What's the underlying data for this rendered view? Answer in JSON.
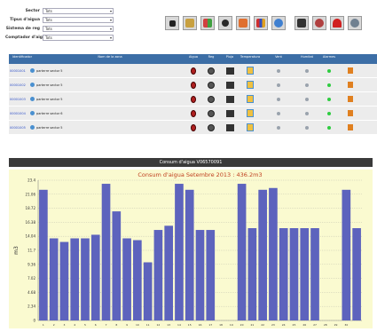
{
  "filters": [
    {
      "label": "Sector",
      "value": "Tots"
    },
    {
      "label": "Tipus d'aigua",
      "value": "Tots"
    },
    {
      "label": "Sistema de reg",
      "value": "Tots"
    },
    {
      "label": "Comptador d'aigua",
      "value": "Tots"
    }
  ],
  "toolbar_icons": [
    "stop-icon",
    "tap-icon",
    "map-icon",
    "valve-icon",
    "calendar-icon",
    "chart-icon",
    "clock-icon",
    "screen-icon",
    "gauge-icon",
    "heart-icon",
    "settings-icon"
  ],
  "table": {
    "headers": {
      "id": "Identificador",
      "name": "Nom de la zona",
      "aigua": "Aigua",
      "reg": "Reg",
      "pluja": "Pluja",
      "temperatura": "Temperatura",
      "vent": "Vent",
      "humitat": "Humitat",
      "alarmes": "Alarmes"
    },
    "rows": [
      {
        "id": "00001001",
        "name": "parterre sector 5",
        "vent": "#9aa3ad",
        "humitat": "#2ecc40"
      },
      {
        "id": "00001002",
        "name": "parterre sector 5",
        "vent": "#9aa3ad",
        "humitat": "#2ecc40"
      },
      {
        "id": "00001003",
        "name": "parterre sector 5",
        "vent": "#9aa3ad",
        "humitat": "#2ecc40"
      },
      {
        "id": "00001004",
        "name": "parterre sector 6",
        "vent": "#9aa3ad",
        "humitat": "#2ecc40"
      },
      {
        "id": "00001005",
        "name": "parterre sector 5",
        "vent": "#9aa3ad",
        "humitat": "#2ecc40"
      }
    ]
  },
  "chart_panel_title": "Consum d'aigua V06570091",
  "chart_data": {
    "type": "bar",
    "title": "Consum d'aigua Setembre 2013 : 436.2m3",
    "ylabel": "m3",
    "xlabel": "",
    "ylim": [
      0,
      23.4
    ],
    "yticks": [
      0,
      2.34,
      4.68,
      7.02,
      9.36,
      11.7,
      14.04,
      16.38,
      18.72,
      21.06,
      23.4
    ],
    "ytick_labels": [
      "0",
      "2.34",
      "4.68",
      "7.02",
      "9.36",
      "11.7",
      "14.04",
      "16.38",
      "18.72",
      "21.06",
      "23.4"
    ],
    "categories": [
      "1",
      "2",
      "3",
      "4",
      "5",
      "6",
      "7",
      "8",
      "9",
      "10",
      "11",
      "12",
      "13",
      "14",
      "15",
      "16",
      "17",
      "18",
      "19",
      "20",
      "21",
      "22",
      "23",
      "24",
      "25",
      "26",
      "27",
      "28",
      "29",
      "30"
    ],
    "values": [
      21.8,
      13.7,
      13.1,
      13.7,
      13.7,
      14.3,
      22.8,
      18.2,
      13.7,
      13.4,
      9.7,
      15.1,
      15.8,
      22.8,
      21.8,
      15.1,
      15.1,
      0,
      0,
      22.8,
      15.4,
      21.8,
      22.1,
      15.4,
      15.4,
      15.4,
      15.4,
      0,
      0,
      21.8,
      15.4
    ],
    "colors": {
      "bar": "#5d63bd",
      "background": "#fafad0",
      "grid": "#b8b8a8"
    }
  }
}
